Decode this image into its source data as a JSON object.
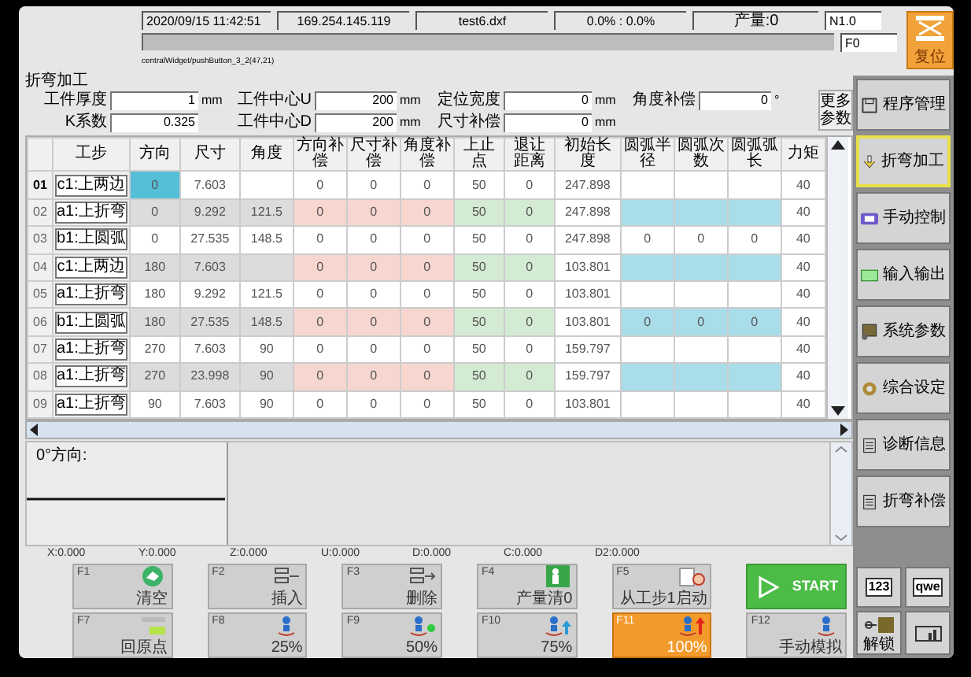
{
  "status_bar": {
    "datetime": "2020/09/15 11:42:51",
    "ip": "169.254.145.119",
    "file": "test6.dxf",
    "ratio": "0.0% : 0.0%",
    "output": "产量:0",
    "n_code": "N1.0",
    "f_code": "F0",
    "progress": {
      "level": 0
    },
    "widget_path": "centralWidget/pushButton_3_2(47,21)"
  },
  "reset_button": {
    "label": "复位"
  },
  "params": {
    "title": "折弯加工",
    "groups": [
      [
        {
          "label": "工件厚度",
          "value": "1",
          "unit": "mm"
        },
        {
          "label": "K系数",
          "value": "0.325"
        }
      ],
      [
        {
          "label": "工件中心U",
          "value": "200",
          "unit": "mm"
        },
        {
          "label": "工件中心D",
          "value": "200",
          "unit": "mm"
        }
      ],
      [
        {
          "label": "定位宽度",
          "value": "0",
          "unit": "mm"
        },
        {
          "label": "尺寸补偿",
          "value": "0",
          "unit": "mm"
        }
      ],
      [
        {
          "label": "角度补偿",
          "value": "0",
          "unit": "°"
        }
      ]
    ],
    "more_button": "更多参数"
  },
  "table": {
    "columns": [
      "工步",
      "方向",
      "尺寸",
      "角度",
      "方向补偿",
      "尺寸补偿",
      "角度补偿",
      "上止点",
      "退让距离",
      "初始长度",
      "圆弧半径",
      "圆弧次数",
      "圆弧弧长",
      "力矩"
    ],
    "rows": [
      {
        "number": "01",
        "step": "c1:上两边",
        "selected": true,
        "shaded": false,
        "direction": "0",
        "size": "7.603",
        "dir_comp": "0",
        "size_comp": "0",
        "angle_comp": "0",
        "top_dead_center": "50",
        "retreat": "0",
        "initial_length": "247.898",
        "torque": "40"
      },
      {
        "number": "02",
        "step": "a1:上折弯",
        "selected": false,
        "shaded": true,
        "direction": "0",
        "size": "9.292",
        "angle": "121.5",
        "dir_comp": "0",
        "size_comp": "0",
        "angle_comp": "0",
        "top_dead_center": "50",
        "retreat": "0",
        "initial_length": "247.898",
        "torque": "40"
      },
      {
        "number": "03",
        "step": "b1:上圆弧",
        "selected": false,
        "shaded": false,
        "direction": "0",
        "size": "27.535",
        "angle": "148.5",
        "dir_comp": "0",
        "size_comp": "0",
        "angle_comp": "0",
        "top_dead_center": "50",
        "retreat": "0",
        "initial_length": "247.898",
        "arc_radius": "0",
        "arc_count": "0",
        "arc_length": "0",
        "torque": "40"
      },
      {
        "number": "04",
        "step": "c1:上两边",
        "selected": false,
        "shaded": true,
        "direction": "180",
        "size": "7.603",
        "dir_comp": "0",
        "size_comp": "0",
        "angle_comp": "0",
        "top_dead_center": "50",
        "retreat": "0",
        "initial_length": "103.801",
        "torque": "40"
      },
      {
        "number": "05",
        "step": "a1:上折弯",
        "selected": false,
        "shaded": false,
        "direction": "180",
        "size": "9.292",
        "angle": "121.5",
        "dir_comp": "0",
        "size_comp": "0",
        "angle_comp": "0",
        "top_dead_center": "50",
        "retreat": "0",
        "initial_length": "103.801",
        "torque": "40"
      },
      {
        "number": "06",
        "step": "b1:上圆弧",
        "selected": false,
        "shaded": true,
        "direction": "180",
        "size": "27.535",
        "angle": "148.5",
        "dir_comp": "0",
        "size_comp": "0",
        "angle_comp": "0",
        "top_dead_center": "50",
        "retreat": "0",
        "initial_length": "103.801",
        "arc_radius": "0",
        "arc_count": "0",
        "arc_length": "0",
        "torque": "40"
      },
      {
        "number": "07",
        "step": "a1:上折弯",
        "selected": false,
        "shaded": false,
        "direction": "270",
        "size": "7.603",
        "angle": "90",
        "dir_comp": "0",
        "size_comp": "0",
        "angle_comp": "0",
        "top_dead_center": "50",
        "retreat": "0",
        "initial_length": "159.797",
        "torque": "40"
      },
      {
        "number": "08",
        "step": "a1:上折弯",
        "selected": false,
        "shaded": true,
        "direction": "270",
        "size": "23.998",
        "angle": "90",
        "dir_comp": "0",
        "size_comp": "0",
        "angle_comp": "0",
        "top_dead_center": "50",
        "retreat": "0",
        "initial_length": "159.797",
        "torque": "40"
      },
      {
        "number": "09",
        "step": "a1:上折弯",
        "selected": false,
        "shaded": false,
        "direction": "90",
        "size": "7.603",
        "angle": "90",
        "dir_comp": "0",
        "size_comp": "0",
        "angle_comp": "0",
        "top_dead_center": "50",
        "retreat": "0",
        "initial_length": "103.801",
        "torque": "40"
      }
    ]
  },
  "direction_view": {
    "label": "0°方向:"
  },
  "coordinates": [
    "X:0.000",
    "Y:0.000",
    "Z:0.000",
    "U:0.000",
    "D:0.000",
    "C:0.000",
    "D2:0.000"
  ],
  "function_keys": [
    {
      "kind": "function",
      "key": "F1",
      "label": "清空",
      "selected": false
    },
    {
      "kind": "function",
      "key": "F2",
      "label": "插入",
      "selected": false
    },
    {
      "kind": "function",
      "key": "F3",
      "label": "删除",
      "selected": false
    },
    {
      "kind": "function",
      "key": "F4",
      "label": "产量清0",
      "selected": false
    },
    {
      "kind": "function",
      "key": "F5",
      "label": "从工步1启动",
      "selected": false
    },
    {
      "kind": "start",
      "label": "START"
    },
    {
      "kind": "function",
      "key": "F7",
      "label": "回原点",
      "selected": false
    },
    {
      "kind": "function",
      "key": "F8",
      "label": "25%",
      "selected": false
    },
    {
      "kind": "function",
      "key": "F9",
      "label": "50%",
      "selected": false
    },
    {
      "kind": "function",
      "key": "F10",
      "label": "75%",
      "selected": false
    },
    {
      "kind": "function",
      "key": "F11",
      "label": "100%",
      "selected": true
    },
    {
      "kind": "function",
      "key": "F12",
      "label": "手动模拟",
      "selected": false
    }
  ],
  "sidebar": {
    "items": [
      {
        "label": "程序管理",
        "selected": false
      },
      {
        "label": "折弯加工",
        "selected": true
      },
      {
        "label": "手动控制",
        "selected": false
      },
      {
        "label": "输入输出",
        "selected": false
      },
      {
        "label": "系统参数",
        "selected": false
      },
      {
        "label": "综合设定",
        "selected": false
      },
      {
        "label": "诊断信息",
        "selected": false
      },
      {
        "label": "折弯补偿",
        "selected": false
      }
    ]
  },
  "keyboard_buttons": [
    "123",
    "qwe"
  ],
  "unlock_button": {
    "label": "解锁"
  }
}
